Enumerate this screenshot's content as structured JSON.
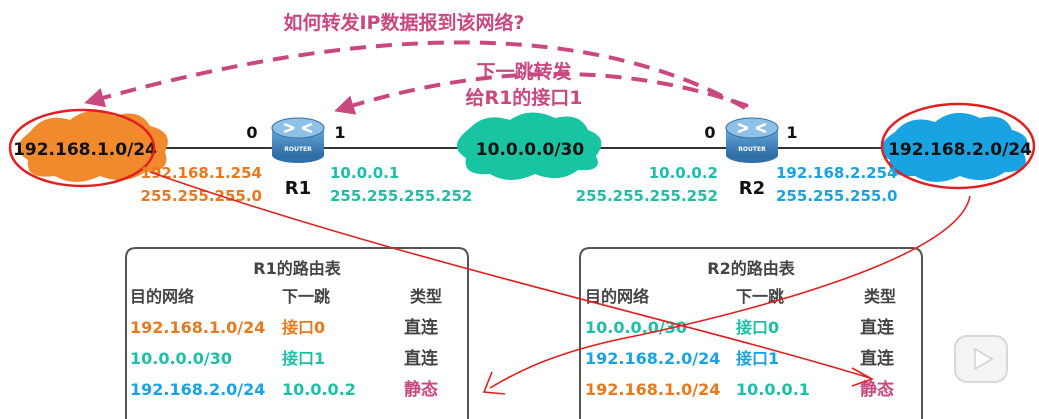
{
  "question": "如何转发IP数据报到该网络?",
  "hint_line1": "下一跳转发",
  "hint_line2": "给R1的接口1",
  "networks": {
    "left": "192.168.1.0/24",
    "middle": "10.0.0.0/30",
    "right": "192.168.2.0/24"
  },
  "routers": {
    "r1": {
      "name": "R1",
      "badge": "ROUTER",
      "port0": "0",
      "port1": "1"
    },
    "r2": {
      "name": "R2",
      "badge": "ROUTER",
      "port0": "0",
      "port1": "1"
    }
  },
  "interfaces": {
    "r1_if0_ip": "192.168.1.254",
    "r1_if0_mask": "255.255.255.0",
    "r1_if1_ip": "10.0.0.1",
    "r1_if1_mask": "255.255.255.252",
    "r2_if0_ip": "10.0.0.2",
    "r2_if0_mask": "255.255.255.252",
    "r2_if1_ip": "192.168.2.254",
    "r2_if1_mask": "255.255.255.0"
  },
  "r1_table": {
    "title": "R1的路由表",
    "headers": [
      "目的网络",
      "下一跳",
      "类型"
    ],
    "rows": [
      [
        "192.168.1.0/24",
        "接口0",
        "直连"
      ],
      [
        "10.0.0.0/30",
        "接口1",
        "直连"
      ],
      [
        "192.168.2.0/24",
        "10.0.0.2",
        "静态"
      ]
    ]
  },
  "r2_table": {
    "title": "R2的路由表",
    "headers": [
      "目的网络",
      "下一跳",
      "类型"
    ],
    "rows": [
      [
        "10.0.0.0/30",
        "接口0",
        "直连"
      ],
      [
        "192.168.2.0/24",
        "接口1",
        "直连"
      ],
      [
        "192.168.1.0/24",
        "10.0.0.1",
        "静态"
      ]
    ]
  },
  "colors": {
    "orange": "#e8791e",
    "teal": "#1dbfa7",
    "blue": "#1aa3e3",
    "magenta": "#c8487f",
    "red_annotation": "#e02020",
    "router": "#4a90c8"
  },
  "icons": [
    "router-icon",
    "play-icon"
  ]
}
